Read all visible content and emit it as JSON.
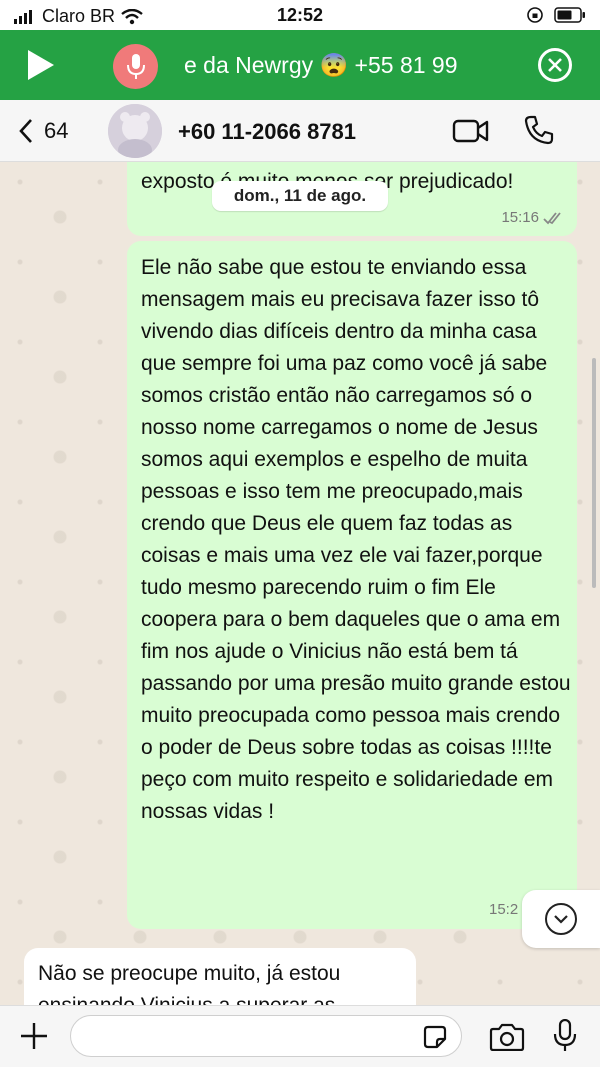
{
  "status_bar": {
    "carrier": "Claro BR",
    "time": "12:52"
  },
  "call_bar": {
    "text": "e da Newrgy 😨  +55 81 99"
  },
  "header": {
    "back_count": "64",
    "contact": "+60 11-2066 8781"
  },
  "date_separator": "dom., 11 de ago.",
  "messages": {
    "previous": {
      "text": "exposto é muito menos ser prejudicado!",
      "time": "15:16"
    },
    "main": {
      "text": "Ele não sabe que estou te enviando essa mensagem mais eu precisava fazer isso tô vivendo dias difíceis dentro da minha casa que sempre foi uma paz como você já sabe somos cristão então não carregamos só o nosso nome carregamos o nome de Jesus somos aqui exemplos e espelho de muita pessoas e isso tem me preocupado,mais crendo que Deus ele quem faz todas as coisas e mais uma vez ele vai fazer,porque tudo mesmo parecendo ruim o fim Ele coopera para o bem daqueles que o ama em fim nos ajude o Vinicius não está bem tá passando por uma presão muito grande estou muito preocupada como pessoa mais crendo o poder de Deus sobre todas as coisas !!!!te peço com muito respeito e solidariedade em nossas vidas !",
      "time": "15:2"
    },
    "incoming": {
      "text": "Não se preocupe muito, já estou ensinando Vinicius a superar as"
    }
  },
  "colors": {
    "call_bar": "#25a244",
    "outgoing_bubble": "#d9fdd3",
    "chat_background": "#efe7dd"
  },
  "icons": [
    "signal-icon",
    "wifi-icon",
    "battery-icon",
    "play-icon",
    "mic-icon",
    "close-icon",
    "back-chevron-icon",
    "video-call-icon",
    "phone-icon",
    "read-ticks-icon",
    "scroll-down-icon",
    "plus-icon",
    "sticker-icon",
    "camera-icon",
    "mic-input-icon"
  ]
}
